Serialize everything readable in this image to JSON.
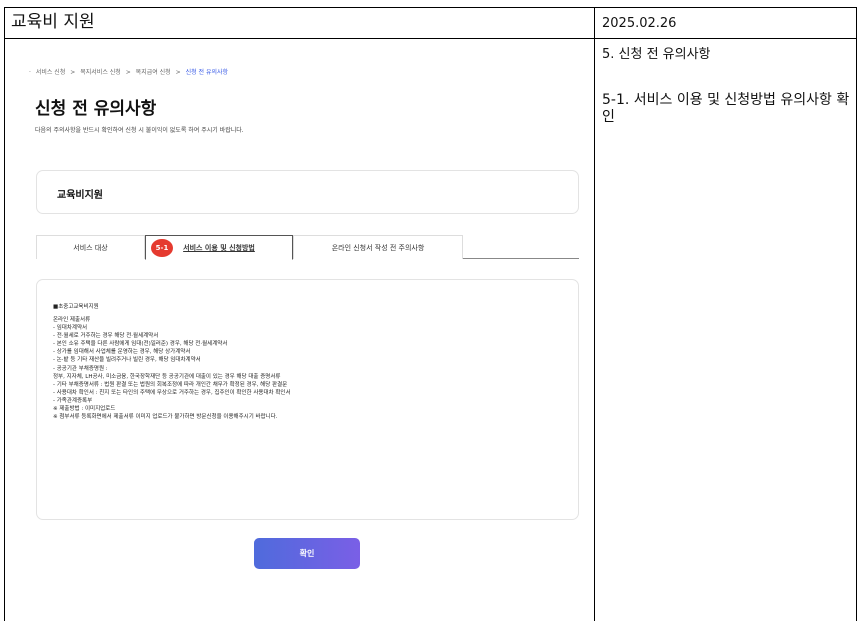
{
  "document": {
    "title": "교육비 지원",
    "date": "2025.02.26",
    "section": "5. 신청 전 유의사항",
    "subsection": "5-1. 서비스 이용 및 신청방법 유의사항 확인"
  },
  "breadcrumb": {
    "items": [
      "서비스 신청",
      "복지서비스 신청",
      "복지급여 신청",
      "신청 전 유의사항"
    ],
    "separator": ">"
  },
  "page": {
    "title": "신청 전 유의사항",
    "description": "다음의 주의사항을 반드시 확인하여 신청 시 불이익이 없도록 하여 주시기 바랍니다."
  },
  "service": {
    "name": "교육비지원"
  },
  "tabs": [
    {
      "label": "서비스 대상"
    },
    {
      "label": "서비스 이용 및 신청방법",
      "badge": "5-1",
      "active": true
    },
    {
      "label": "온라인 신청서 작성 전 주의사항"
    }
  ],
  "content": {
    "title": "■초중고교육비지원",
    "lines": [
      "온라인 제출서류",
      "- 임대차계약서",
      "- 전·월세로 거주하는 경우 해당 전·월세계약서",
      "- 본인 소유 주택을 다른 사람에게 임대(전)일러준) 경우, 해당 전·월세계약서",
      "- 상가를 임대해서 사업체를 운영하는 경우, 해당 상가계약서",
      "- 논·밭 등 기타 재산을 빌려주거나 빌린 경우, 해당 임대차계약서",
      "- 공공기관 부채증명원 :",
      "정부, 지자체, LH공사, 미소금융, 한국장학재단 등 공공기관에 대출이 있는 경우 해당 대출 증명서류",
      "- 기타 부채증명서류 : 법원 판결 또는 법원의 회복조정에 따라 개인간 채무가 확정된 경우, 해당 판결문",
      "- 사용대차 확인서 : 친지 또는 타인의 주택에 무상으로 거주하는 경우, 집주인이 확인한 사용대차 확인서",
      "- 가족관계증록부",
      "※ 제출방법 : 이미지업로드",
      "※ 첨부서류 등록화면에서 제출서류 이미지 업로드가 불가하면 방문신청을 이용해주시기 바랍니다."
    ]
  },
  "buttons": {
    "confirm": "확인"
  },
  "colors": {
    "accent": "#4f6bdc",
    "badge": "#e53a2f",
    "breadcrumb_current": "#3356e6"
  }
}
